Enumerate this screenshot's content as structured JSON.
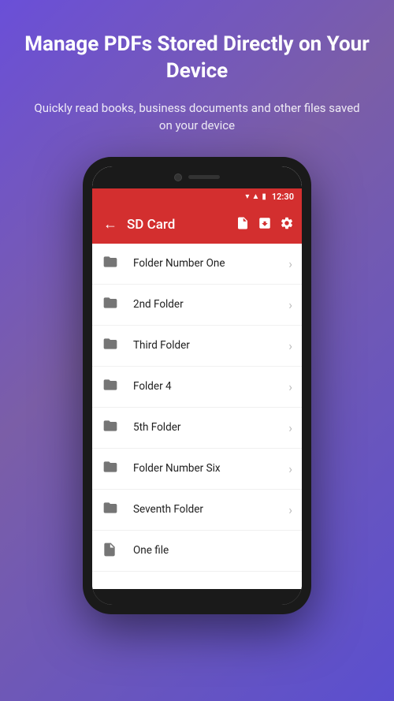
{
  "hero": {
    "title": "Manage PDFs Stored Directly on Your Device",
    "subtitle": "Quickly read books, business documents and other files saved on your device"
  },
  "status_bar": {
    "time": "12:30"
  },
  "app_bar": {
    "title": "SD Card",
    "back_label": "←"
  },
  "folders": [
    {
      "id": 1,
      "name": "Folder Number One",
      "type": "folder"
    },
    {
      "id": 2,
      "name": "2nd Folder",
      "type": "folder"
    },
    {
      "id": 3,
      "name": "Third Folder",
      "type": "folder"
    },
    {
      "id": 4,
      "name": "Folder 4",
      "type": "folder"
    },
    {
      "id": 5,
      "name": "5th Folder",
      "type": "folder"
    },
    {
      "id": 6,
      "name": "Folder Number Six",
      "type": "folder"
    },
    {
      "id": 7,
      "name": "Seventh Folder",
      "type": "folder"
    },
    {
      "id": 8,
      "name": "One file",
      "type": "file"
    }
  ]
}
